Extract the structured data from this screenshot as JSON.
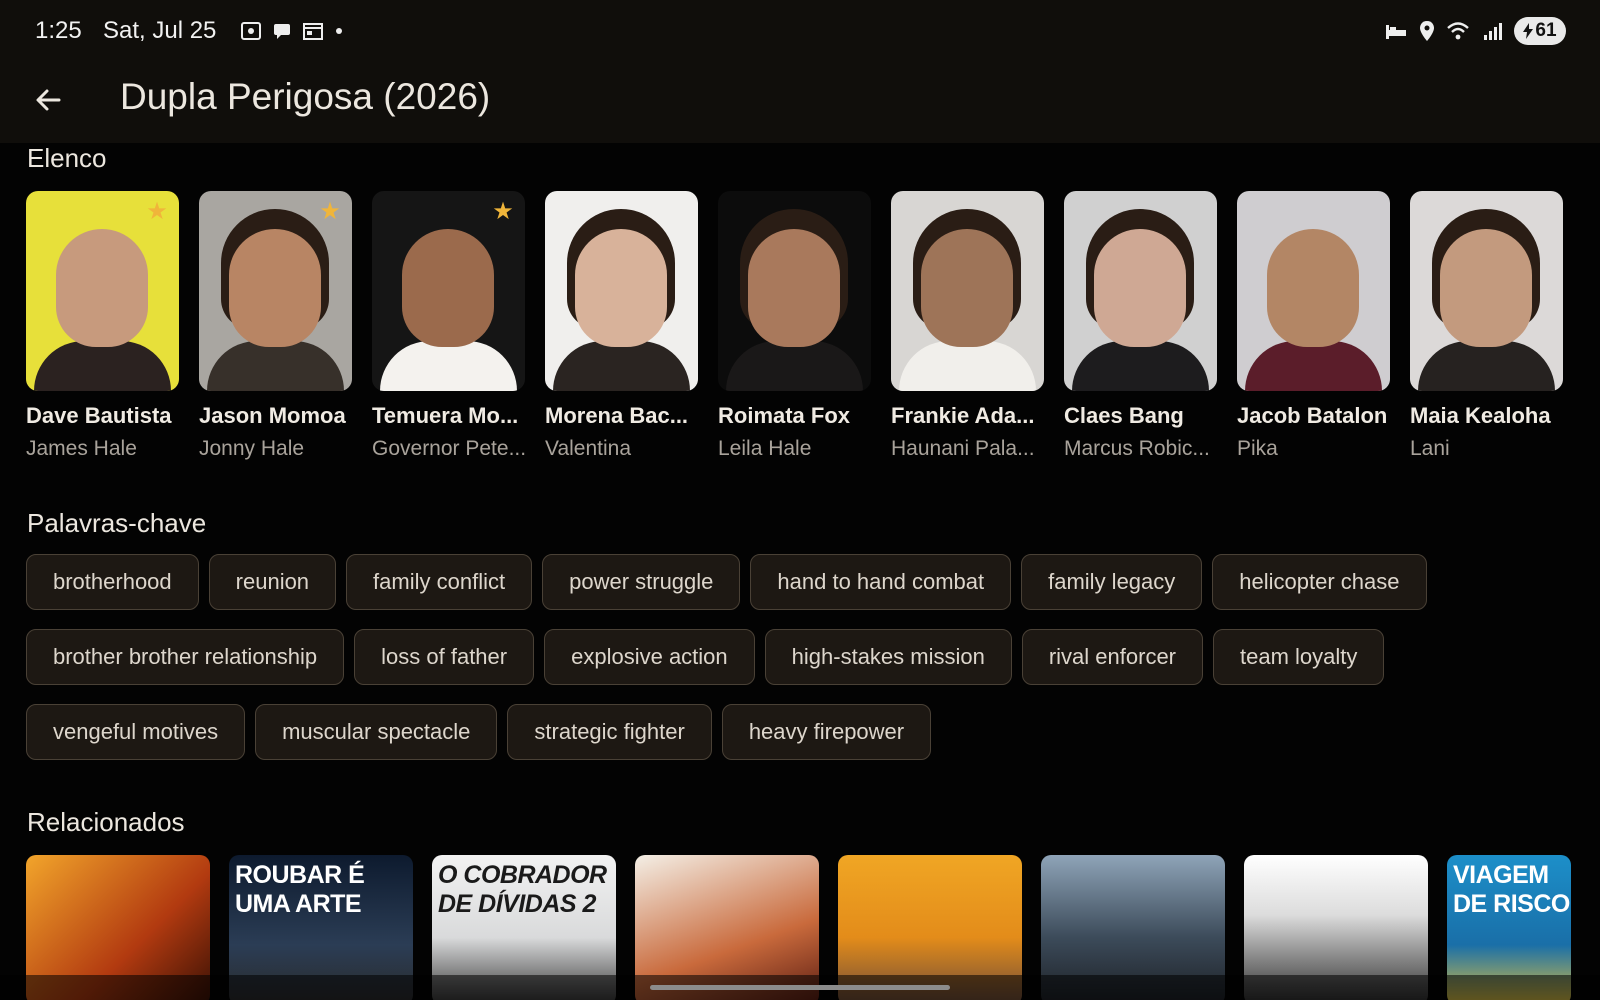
{
  "status": {
    "time": "1:25",
    "date": "Sat, Jul 25",
    "battery": "61"
  },
  "header": {
    "title": "Dupla Perigosa (2026)"
  },
  "cast": {
    "title": "Elenco",
    "items": [
      {
        "name": "Dave Bautista",
        "role": "James Hale",
        "starred": true,
        "bg": "#e7e03a",
        "skin": "#c79a7d",
        "shirt": "#2b2220"
      },
      {
        "name": "Jason Momoa",
        "role": "Jonny Hale",
        "starred": true,
        "bg": "#a9a6a1",
        "skin": "#b88564",
        "shirt": "#37302a"
      },
      {
        "name": "Temuera Mo...",
        "role": "Governor Pete...",
        "starred": true,
        "bg": "#151515",
        "skin": "#9b6a4c",
        "shirt": "#f4f2ee"
      },
      {
        "name": "Morena Bac...",
        "role": "Valentina",
        "starred": false,
        "bg": "#f0efed",
        "skin": "#d8b29a",
        "shirt": "#2a2421"
      },
      {
        "name": "Roimata Fox",
        "role": "Leila Hale",
        "starred": false,
        "bg": "#0c0c0c",
        "skin": "#a9795c",
        "shirt": "#1a1818"
      },
      {
        "name": "Frankie Ada...",
        "role": "Haunani Pala...",
        "starred": false,
        "bg": "#d8d6d3",
        "skin": "#9e7458",
        "shirt": "#f1efeb"
      },
      {
        "name": "Claes Bang",
        "role": "Marcus Robic...",
        "starred": false,
        "bg": "#d0d0d0",
        "skin": "#cfa894",
        "shirt": "#1d1c1e"
      },
      {
        "name": "Jacob Batalon",
        "role": "Pika",
        "starred": false,
        "bg": "#cfcdd0",
        "skin": "#b38665",
        "shirt": "#5b1d2a"
      },
      {
        "name": "Maia Kealoha",
        "role": "Lani",
        "starred": false,
        "bg": "#dcd9d8",
        "skin": "#c39a7e",
        "shirt": "#262220"
      }
    ]
  },
  "keywords": {
    "title": "Palavras-chave",
    "rows": [
      [
        "brotherhood",
        "reunion",
        "family conflict",
        "power struggle",
        "hand to hand combat",
        "family legacy",
        "helicopter chase"
      ],
      [
        "brother brother relationship",
        "loss of father",
        "explosive action",
        "high-stakes mission",
        "rival enforcer",
        "team loyalty"
      ],
      [
        "vengeful motives",
        "muscular spectacle",
        "strategic fighter",
        "heavy firepower"
      ]
    ]
  },
  "related": {
    "title": "Relacionados",
    "items": [
      {
        "label": "",
        "bg": "linear-gradient(135deg,#f2a52b,#b23a10 60%,#3a1105)"
      },
      {
        "label": "ROUBAR É UMA ARTE",
        "bg": "linear-gradient(180deg,#0d1a2e,#2b3d55 60%,#2a2a2a)"
      },
      {
        "label": "O COBRADOR DE DÍVIDAS 2",
        "bg": "linear-gradient(180deg,#f2f2f2,#d9dadb 55%,#333)"
      },
      {
        "label": "",
        "bg": "linear-gradient(160deg,#f4efe6,#c96a3c 60%,#5a1c12)"
      },
      {
        "label": "",
        "bg": "linear-gradient(180deg,#f0a624,#e38c1a 55%,#6b4b3a)"
      },
      {
        "label": "",
        "bg": "linear-gradient(180deg,#8fa4b8,#3c4b5a 55%,#1c1f24)"
      },
      {
        "label": "",
        "bg": "linear-gradient(180deg,#ffffff,#dcdcdc 40%,#2b2b2b)"
      },
      {
        "label": "VIAGEM DE RISCO",
        "bg": "linear-gradient(180deg,#1c8fc9,#1a6fa8 60%,#e3c23c)"
      }
    ]
  },
  "colors": {
    "accent_star": "#f0b53a",
    "background": "#030303",
    "chip_border": "#4a4136"
  }
}
